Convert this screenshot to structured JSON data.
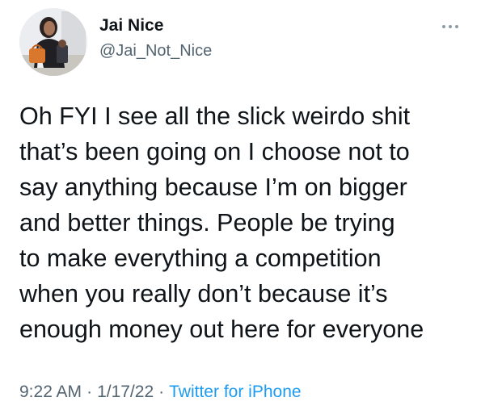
{
  "user": {
    "display_name": "Jai Nice",
    "handle": "@Jai_Not_Nice",
    "avatar_icon": "profile-photo-icon"
  },
  "tweet": {
    "lines": [
      "Oh FYI I see all the slick weirdo shit",
      "that’s been going on I choose not to",
      "say anything because I’m on bigger",
      "and better things. People be trying",
      "to make everything a competition",
      "when you really don’t because it’s",
      "enough money out here for everyone"
    ]
  },
  "meta": {
    "time": "9:22 AM",
    "separator": "·",
    "date": "1/17/22",
    "source": "Twitter for iPhone"
  },
  "icons": {
    "more": "more-icon"
  },
  "colors": {
    "text": "#0f1419",
    "secondary": "#536471",
    "link": "#1d9bf0",
    "background": "#ffffff"
  }
}
